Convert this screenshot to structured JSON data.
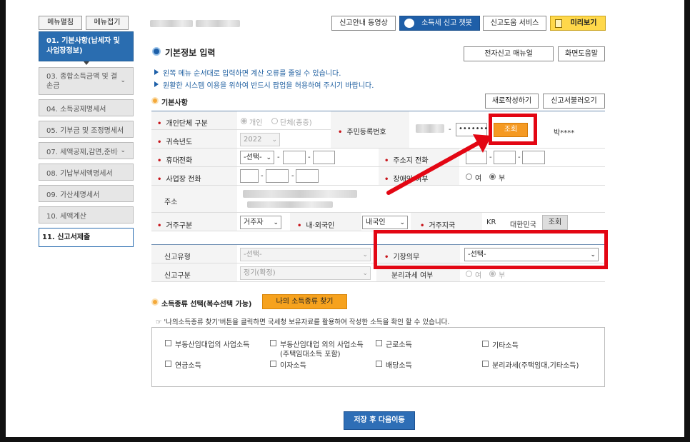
{
  "sidebar": {
    "expand_label": "메뉴펼침",
    "collapse_label": "메뉴접기",
    "items": [
      {
        "label": "01. 기본사항(납세자 및 사업장정보)"
      },
      {
        "label": "03. 종합소득금액 및 결손금"
      },
      {
        "label": "04. 소득공제명세서"
      },
      {
        "label": "05. 기부금 및 조정명세서"
      },
      {
        "label": "07. 세액공제,감면,준비금"
      },
      {
        "label": "08. 기납부세액명세서"
      },
      {
        "label": "09. 가산세명세서"
      },
      {
        "label": "10. 세액계산"
      },
      {
        "label": "11. 신고서제출"
      }
    ]
  },
  "header": {
    "video_guide": "신고안내 동영상",
    "chatbot": "소득세 신고 챗봇",
    "help_service": "신고도움 서비스",
    "preview": "미리보기"
  },
  "page": {
    "title": "기본정보 입력",
    "manual_button": "전자신고 매뉴얼",
    "screen_help_button": "화면도움말",
    "notices": [
      "왼쪽 메뉴 순서대로 입력하면 계산 오류를 줄일 수 있습니다.",
      "원활한 시스템 이용을 위하여 반드시 팝업을 허용하여 주시기 바랍니다."
    ]
  },
  "basic": {
    "section_title": "기본사항",
    "new_button": "새로작성하기",
    "load_button": "신고서불러오기",
    "taxpayer_type_label": "개인단체 구분",
    "opt_individual": "개인",
    "opt_group": "단체(종중)",
    "year_label": "귀속년도",
    "year_value": "2022",
    "rrn_label": "주민등록번호",
    "rrn_back": "•••••••",
    "lookup_button": "조회",
    "name_value": "박****",
    "mobile_label": "휴대전화",
    "mobile_prefix": "-선택-",
    "address_phone_label": "주소지 전화",
    "biz_phone_label": "사업장 전화",
    "disabled_label": "장애인 여부",
    "opt_yes": "여",
    "opt_no": "부",
    "address_label": "주소",
    "residence_label": "거주구분",
    "residence_value": "거주자",
    "nationality_label": "내·외국인",
    "nationality_value": "내국인",
    "country_label": "거주지국",
    "country_code": "KR",
    "country_name": "대한민국",
    "country_lookup": "조회"
  },
  "report": {
    "type_label": "신고유형",
    "type_value": "-선택-",
    "bookkeeping_label": "기장의무",
    "bookkeeping_value": "-선택-",
    "category_label": "신고구분",
    "category_value": "정기(확정)",
    "separate_label": "분리과세 여부",
    "opt_yes": "여",
    "opt_no": "부"
  },
  "income": {
    "section_title": "소득종류 선택(복수선택 가능)",
    "find_button": "나의 소득종류 찾기",
    "hint": "☞ '나의소득종류 찾기'버튼을 클릭하면 국세청 보유자료를 활용하여 작성한 소득을 확인 할 수 있습니다.",
    "items": [
      {
        "label": "부동산임대업의 사업소득"
      },
      {
        "label": "부동산임대업 외의 사업소득"
      },
      {
        "label": "근로소득"
      },
      {
        "label": "기타소득"
      },
      {
        "label": "연금소득"
      },
      {
        "label": "이자소득"
      },
      {
        "label": "배당소득"
      },
      {
        "label": "분리과세(주택임대,기타소득)"
      }
    ],
    "item2_sub": "(주택임대소득 포함)"
  },
  "footer": {
    "save_next": "저장 후 다음이동"
  },
  "colors": {
    "accent": "#2a6db0",
    "annotation": "#e30613",
    "lookup_orange": "#f59a23",
    "required": "#c8151b"
  }
}
